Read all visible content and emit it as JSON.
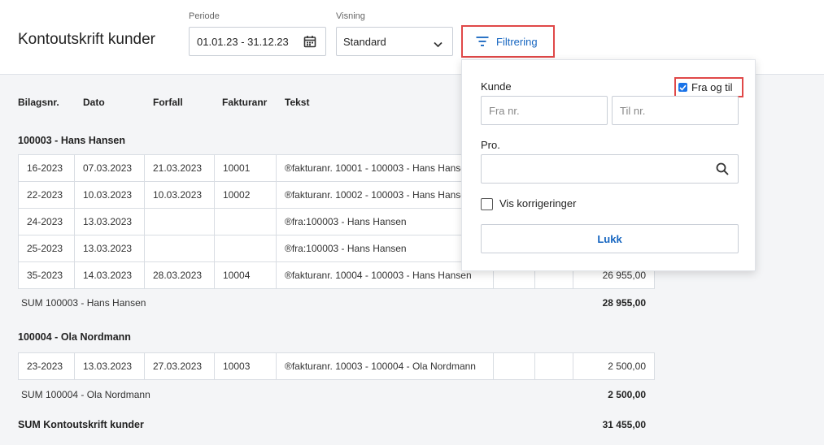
{
  "header": {
    "title": "Kontoutskrift kunder",
    "period_label": "Periode",
    "period_value": "01.01.23 - 31.12.23",
    "view_label": "Visning",
    "view_value": "Standard",
    "filter_label": "Filtrering"
  },
  "columns": [
    "Bilagsnr.",
    "Dato",
    "Forfall",
    "Fakturanr",
    "Tekst"
  ],
  "groups": [
    {
      "title": "100003 - Hans Hansen",
      "rows": [
        [
          "16-2023",
          "07.03.2023",
          "21.03.2023",
          "10001",
          "®fakturanr. 10001 - 100003 - Hans Hansen",
          "",
          "",
          ""
        ],
        [
          "22-2023",
          "10.03.2023",
          "10.03.2023",
          "10002",
          "®fakturanr. 10002 - 100003 - Hans Hansen",
          "",
          "",
          ""
        ],
        [
          "24-2023",
          "13.03.2023",
          "",
          "",
          "®fra:100003 - Hans Hansen",
          "",
          "",
          ""
        ],
        [
          "25-2023",
          "13.03.2023",
          "",
          "",
          "®fra:100003 - Hans Hansen",
          "",
          "",
          ""
        ],
        [
          "35-2023",
          "14.03.2023",
          "28.03.2023",
          "10004",
          "®fakturanr. 10004 - 100003 - Hans Hansen",
          "",
          "",
          "26 955,00"
        ]
      ],
      "sum_label": "SUM 100003 - Hans Hansen",
      "sum_value": "28 955,00"
    },
    {
      "title": "100004 - Ola Nordmann",
      "rows": [
        [
          "23-2023",
          "13.03.2023",
          "27.03.2023",
          "10003",
          "®fakturanr. 10003 - 100004 - Ola Nordmann",
          "",
          "",
          "2 500,00"
        ]
      ],
      "sum_label": "SUM 100004 - Ola Nordmann",
      "sum_value": "2 500,00"
    }
  ],
  "total": {
    "label": "SUM Kontoutskrift kunder",
    "value": "31 455,00"
  },
  "filter_panel": {
    "customer_label": "Kunde",
    "range_label": "Fra og til",
    "range_checked": true,
    "from_placeholder": "Fra nr.",
    "to_placeholder": "Til nr.",
    "project_label": "Pro.",
    "corrections_label": "Vis korrigeringer",
    "corrections_checked": false,
    "close_label": "Lukk"
  },
  "colors": {
    "accent": "#1565c0",
    "highlight": "#e04848",
    "checkbox": "#1a73e8"
  }
}
